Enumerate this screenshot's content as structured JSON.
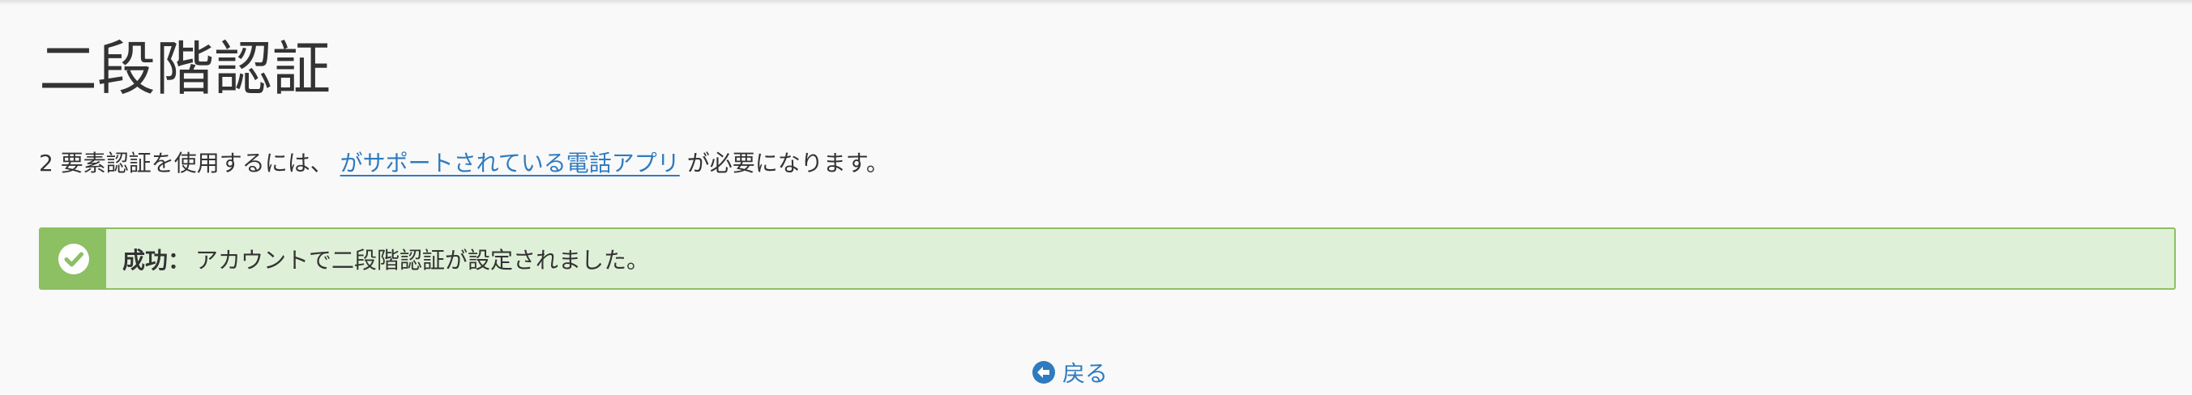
{
  "page": {
    "title": "二段階認証"
  },
  "intro": {
    "prefix": "2 要素認証を使用するには、",
    "link_text": "がサポートされている電話アプリ",
    "suffix": "が必要になります。"
  },
  "alert": {
    "label": "成功：",
    "message": "アカウントで二段階認証が設定されました。",
    "icon": "check-circle-icon",
    "background_color": "#dff0d8",
    "accent_color": "#8cc063"
  },
  "back": {
    "label": "戻る",
    "icon": "arrow-left-circle-icon",
    "link_color": "#2f7bbf"
  }
}
